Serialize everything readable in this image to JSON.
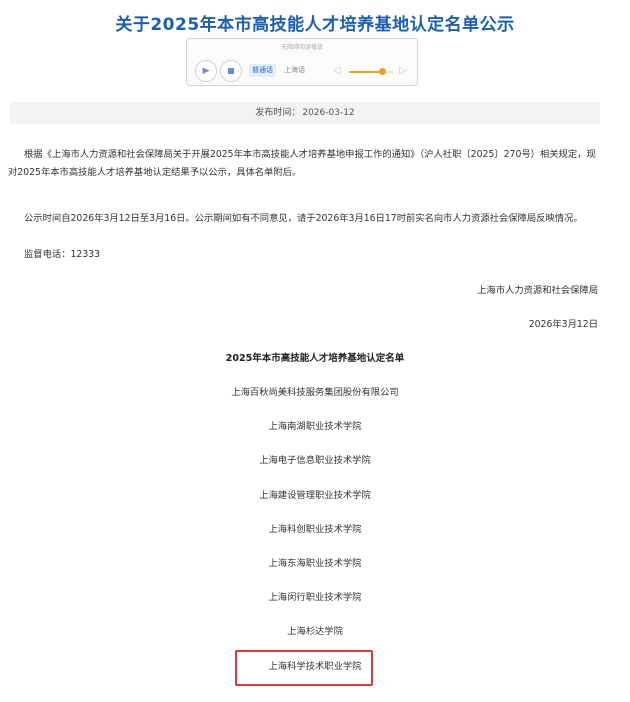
{
  "title": "关于2025年本市高技能人才培养基地认定名单公示",
  "player": {
    "caption": "无障碍阅读播放",
    "play_icon": "play-icon",
    "stop_icon": "stop-icon",
    "lang_active": "普通话",
    "lang_other": "上海话",
    "volume_level": 0.75
  },
  "publish": {
    "label": "发布时间：",
    "date": "2026-03-12"
  },
  "body": {
    "p1": "根据《上海市人力资源和社会保障局关于开展2025年本市高技能人才培养基地申报工作的通知》（沪人社职〔2025〕270号）相关规定，现对2025年本市高技能人才培养基地认定结果予以公示，具体名单附后。",
    "p2": "公示时间自2026年3月12日至3月16日。公示期间如有不同意见，请于2026年3月16日17时前实名向市人力资源社会保障局反映情况。",
    "p3": "监督电话：12333"
  },
  "signature": {
    "org": "上海市人力资源和社会保障局",
    "date": "2026年3月12日"
  },
  "list_title": "2025年本市高技能人才培养基地认定名单",
  "list": [
    "上海百秋尚美科技服务集团股份有限公司",
    "上海南湖职业技术学院",
    "上海电子信息职业技术学院",
    "上海建设管理职业技术学院",
    "上海科创职业技术学院",
    "上海东海职业技术学院",
    "上海闵行职业技术学院",
    "上海杉达学院",
    "上海科学技术职业学院"
  ],
  "highlight_color": "#e03a3a",
  "title_color": "#1a5fb4"
}
